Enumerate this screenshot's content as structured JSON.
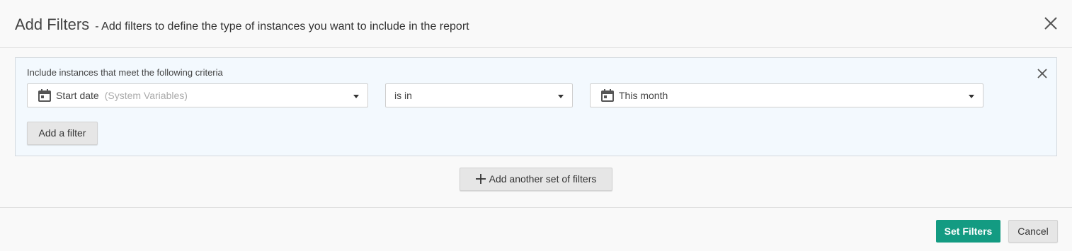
{
  "modal": {
    "title": "Add Filters",
    "subtitle": "- Add filters to define the type of instances you want to include in the report",
    "close_icon": "close-icon"
  },
  "filter_set": {
    "criteria_label": "Include instances that meet the following criteria",
    "close_icon": "close-icon",
    "field": {
      "value": "Start date",
      "hint": "(System Variables)",
      "icon": "calendar-icon"
    },
    "operator": {
      "value": "is in"
    },
    "value": {
      "value": "This month",
      "icon": "calendar-icon"
    },
    "add_filter_label": "Add a filter"
  },
  "add_set_label": "Add another set of filters",
  "footer": {
    "set_filters_label": "Set Filters",
    "cancel_label": "Cancel"
  },
  "colors": {
    "primary": "#139b82",
    "panel_bg": "#f3f9fe",
    "page_bg": "#f9f9f9"
  }
}
